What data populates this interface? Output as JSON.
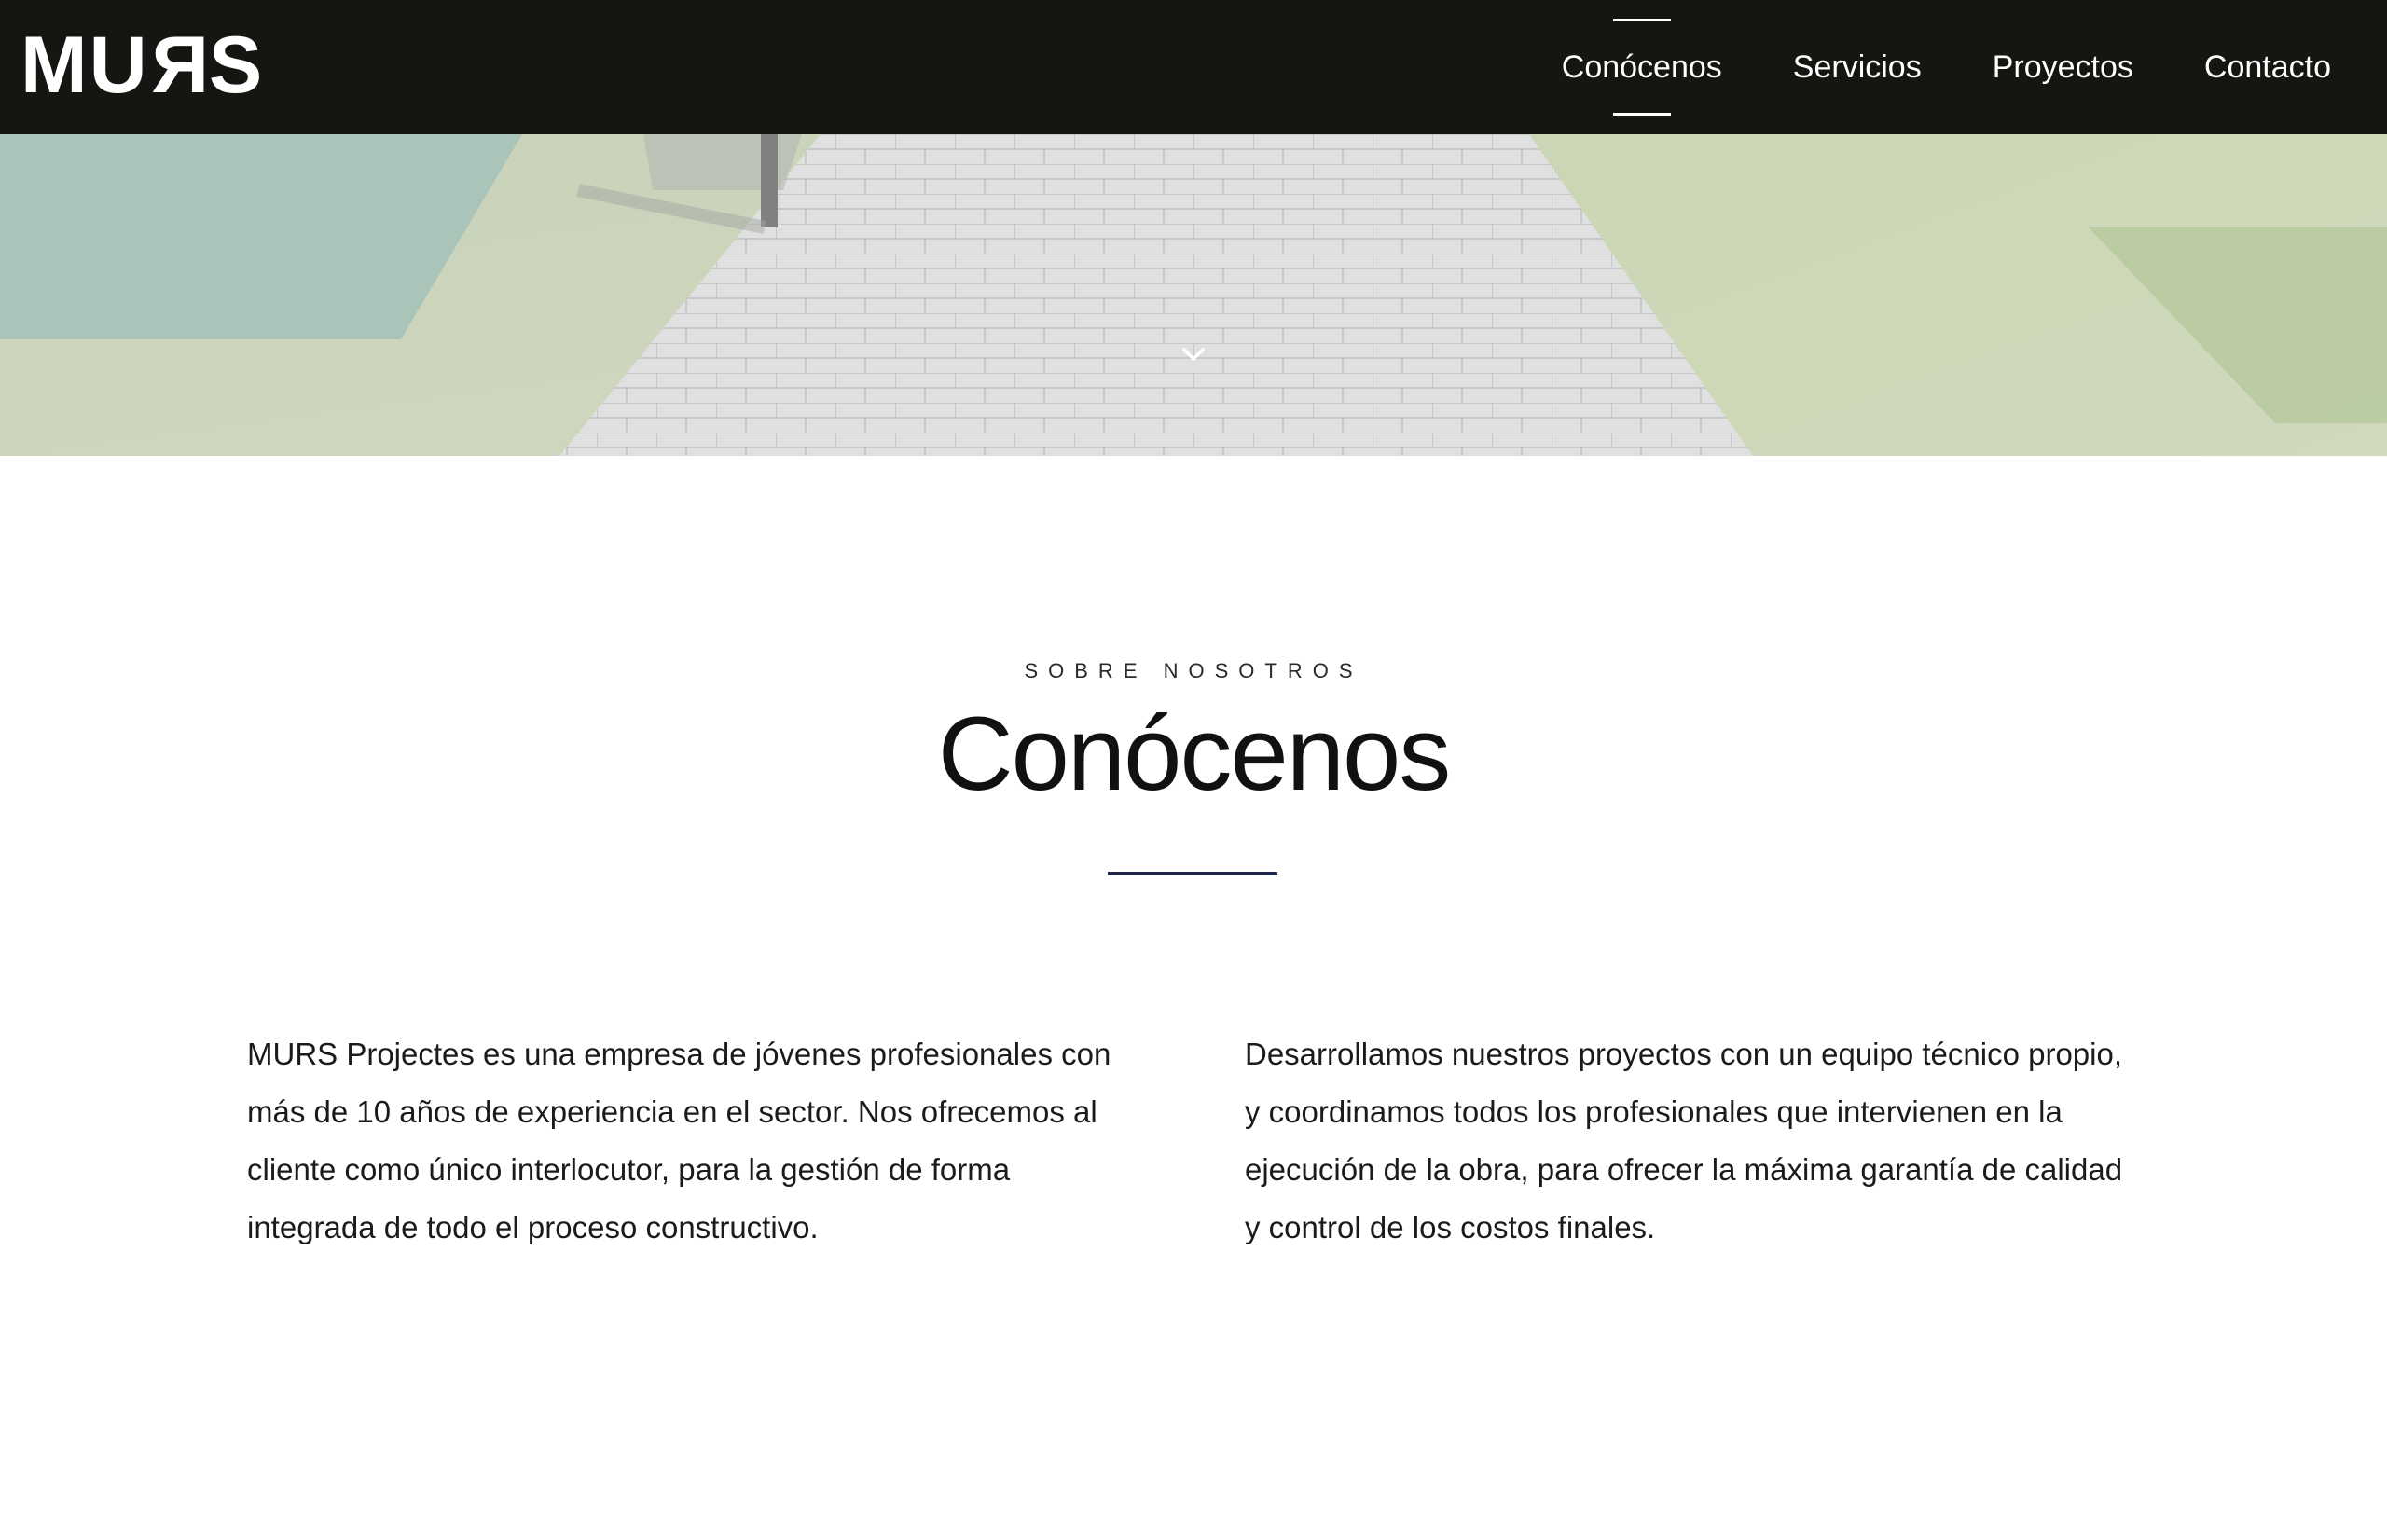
{
  "brand": {
    "logo_text": "MURS"
  },
  "nav": {
    "items": [
      {
        "label": "Conócenos",
        "active": true
      },
      {
        "label": "Servicios",
        "active": false
      },
      {
        "label": "Proyectos",
        "active": false
      },
      {
        "label": "Contacto",
        "active": false
      }
    ]
  },
  "hero": {
    "scroll_icon": "chevron-down-icon"
  },
  "about": {
    "eyebrow": "SOBRE NOSOTROS",
    "title": "Conócenos",
    "paragraph_left": "MURS Projectes es una empresa de jóvenes profesionales con más de 10 años de experiencia en el sector. Nos ofrecemos al cliente como único interlocutor, para la gestión de forma integrada de todo el proceso constructivo.",
    "paragraph_right": "Desarrollamos nuestros proyectos con un equipo técnico propio, y coordinamos todos los profesionales que intervienen en la ejecución de la obra, para ofrecer la máxima garantía de calidad y control de los costos finales."
  },
  "colors": {
    "navbar_bg": "#151512",
    "accent_rule": "#1c2550",
    "text": "#1b1b1b"
  }
}
